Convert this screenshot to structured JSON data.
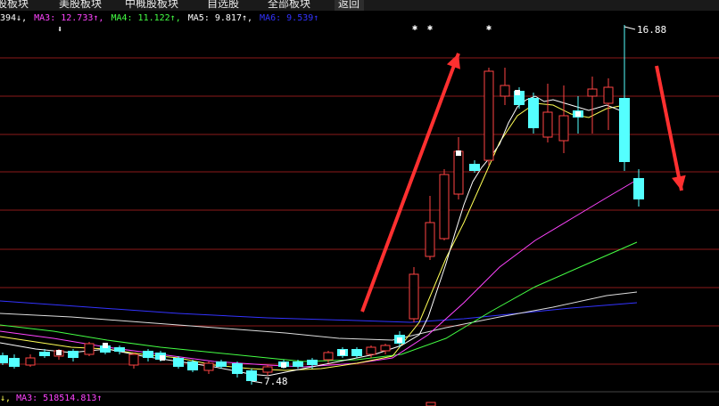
{
  "tabs": [
    "股板块",
    "美股板块",
    "中概股板块",
    "自选股",
    "全部板块",
    "返回"
  ],
  "ma_header": {
    "ma2_tail": "394↓,",
    "ma3_label": "MA3: 12.733↑,",
    "ma4_label": "MA4: 11.122↑,",
    "ma5_label": "MA5: 9.817↑,",
    "ma6_label": "MA6: 9.539↑"
  },
  "bottom_header": {
    "vol_tail": "↓,",
    "vma3_label": "MA3: 518514.813↑"
  },
  "annotations": {
    "high_price": "16.88",
    "low_price": "7.48"
  },
  "colors": {
    "up": "#ff4444",
    "down": "#54ffff",
    "grid": "#8b1a1a",
    "ma2": "#ffffff",
    "ma3": "#ff44ff",
    "ma4": "#44ff44",
    "ma5": "#ffff55",
    "ma6": "#3333ff",
    "arrow": "#ff3030"
  }
}
